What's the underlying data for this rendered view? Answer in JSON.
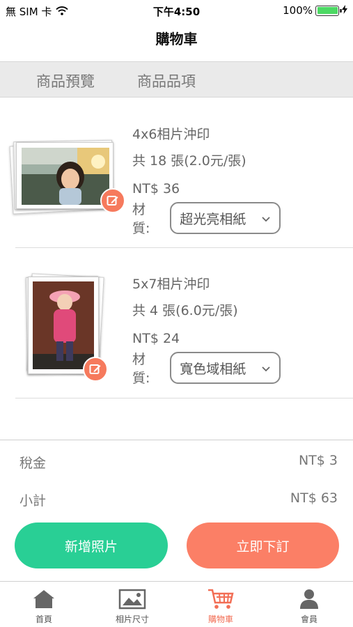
{
  "status_bar": {
    "carrier": "無 SIM 卡",
    "time": "下午4:50",
    "battery": "100%",
    "battery_level": 1.0
  },
  "nav": {
    "title": "購物車"
  },
  "tabs": [
    {
      "label": "商品預覽"
    },
    {
      "label": "商品品項"
    }
  ],
  "items": [
    {
      "name": "4x6相片沖印",
      "quantity": "共 18 張(2.0元/張)",
      "price": "NT$ 36",
      "material_label": "材質:",
      "material": "超光亮相紙",
      "icon": "edit-icon"
    },
    {
      "name": "5x7相片沖印",
      "quantity": "共 4 張(6.0元/張)",
      "price": "NT$ 24",
      "material_label": "材質:",
      "material": "寬色域相紙",
      "icon": "edit-icon"
    }
  ],
  "summary": {
    "tax_label": "稅金",
    "tax_value": "NT$ 3",
    "subtotal_label": "小計",
    "subtotal_value": "NT$ 63"
  },
  "buttons": {
    "add_photos": "新增照片",
    "order_now": "立即下訂"
  },
  "tab_bar": [
    {
      "label": "首頁",
      "icon": "home-icon"
    },
    {
      "label": "相片尺寸",
      "icon": "image-icon"
    },
    {
      "label": "購物車",
      "icon": "cart-icon",
      "active": true
    },
    {
      "label": "會員",
      "icon": "user-icon"
    }
  ],
  "colors": {
    "accent": "#f67a5d",
    "add_button": "#29cf95",
    "order_button": "#fb7f66",
    "tab_strip_bg": "#eaeaea",
    "active_tab": "#f26e55"
  }
}
